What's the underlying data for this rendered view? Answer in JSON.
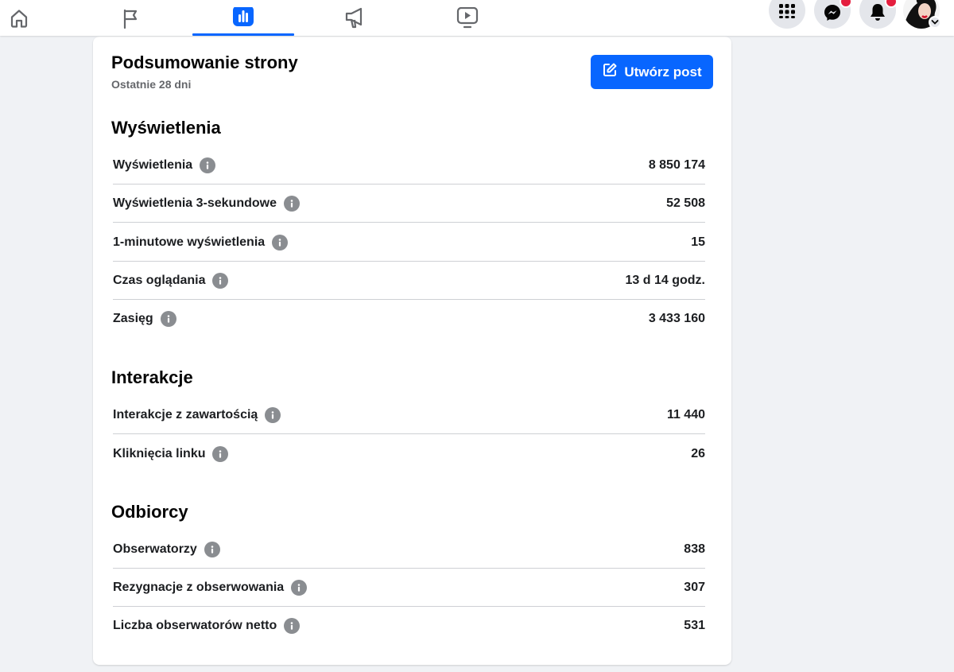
{
  "colors": {
    "accent": "#0866ff",
    "badge": "#e41e3f",
    "page_background": "#f0f2f5"
  },
  "topbar": {
    "tabs": [
      {
        "icon": "home-icon",
        "active": false
      },
      {
        "icon": "flag-icon",
        "active": false
      },
      {
        "icon": "insights-bar-chart-icon",
        "active": true
      },
      {
        "icon": "megaphone-icon",
        "active": false
      },
      {
        "icon": "video-play-icon",
        "active": false
      }
    ],
    "right_buttons": [
      {
        "icon": "menu-grid-icon"
      },
      {
        "icon": "messenger-icon",
        "badge": true
      },
      {
        "icon": "bell-icon",
        "badge": true
      },
      {
        "icon": "profile-avatar"
      }
    ]
  },
  "summary": {
    "title": "Podsumowanie strony",
    "subtitle": "Ostatnie 28 dni",
    "create_post_label": "Utwórz post",
    "create_post_icon": "edit-icon"
  },
  "sections": [
    {
      "title": "Wyświetlenia",
      "metrics": [
        {
          "label": "Wyświetlenia",
          "value": "8 850 174"
        },
        {
          "label": "Wyświetlenia 3-sekundowe",
          "value": "52 508"
        },
        {
          "label": "1-minutowe wyświetlenia",
          "value": "15"
        },
        {
          "label": "Czas oglądania",
          "value": "13 d 14 godz."
        },
        {
          "label": "Zasięg",
          "value": "3 433 160"
        }
      ]
    },
    {
      "title": "Interakcje",
      "metrics": [
        {
          "label": "Interakcje z zawartością",
          "value": "11 440"
        },
        {
          "label": "Kliknięcia linku",
          "value": "26"
        }
      ]
    },
    {
      "title": "Odbiorcy",
      "metrics": [
        {
          "label": "Obserwatorzy",
          "value": "838"
        },
        {
          "label": "Rezygnacje z obserwowania",
          "value": "307"
        },
        {
          "label": "Liczba obserwatorów netto",
          "value": "531"
        }
      ]
    }
  ]
}
